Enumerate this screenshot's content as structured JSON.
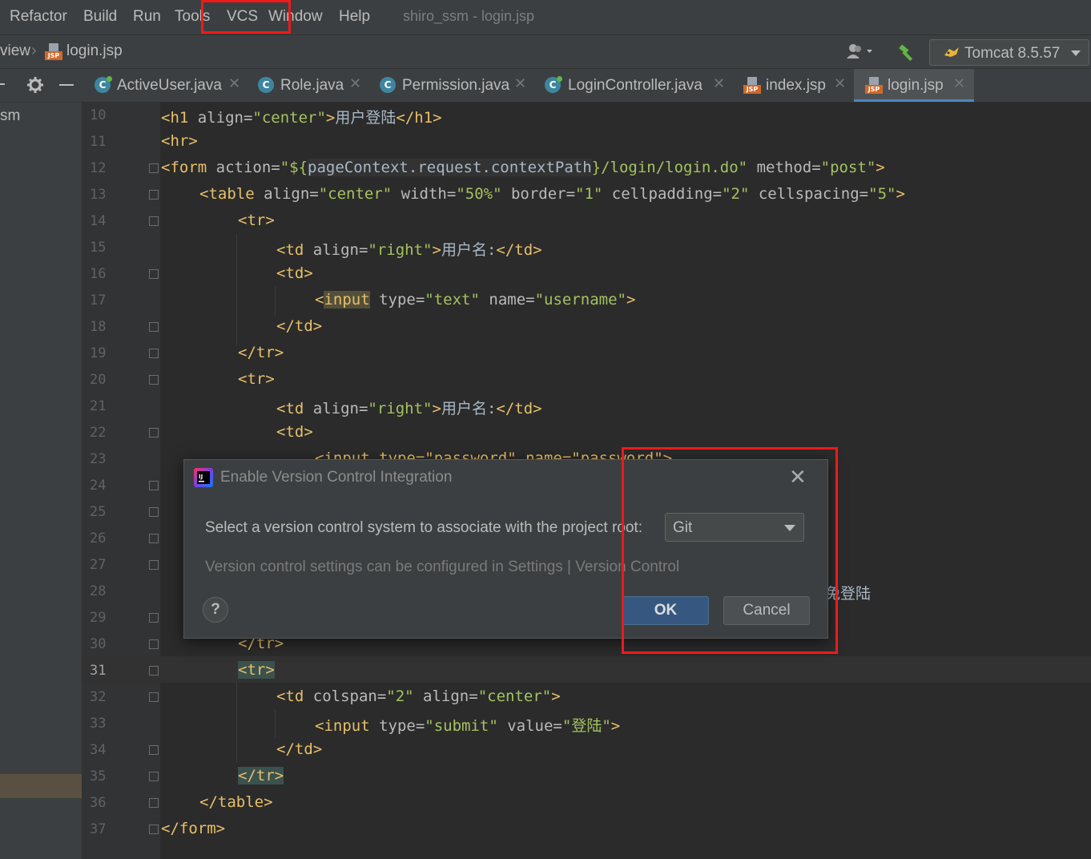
{
  "menu": [
    "Refactor",
    "Build",
    "Run",
    "Tools",
    "VCS",
    "Window",
    "Help"
  ],
  "window_title": "shiro_ssm - login.jsp",
  "nav": {
    "crumb_view": "view",
    "crumb_file": "login.jsp",
    "run_config": "Tomcat 8.5.57"
  },
  "side": {
    "project_fragment": "sm"
  },
  "tabs": [
    {
      "label": "ActiveUser.java",
      "kind": "class"
    },
    {
      "label": "Role.java",
      "kind": "class"
    },
    {
      "label": "Permission.java",
      "kind": "class"
    },
    {
      "label": "LoginController.java",
      "kind": "class"
    },
    {
      "label": "index.jsp",
      "kind": "jsp"
    },
    {
      "label": "login.jsp",
      "kind": "jsp",
      "active": true
    }
  ],
  "line_numbers": [
    "10",
    "11",
    "12",
    "13",
    "14",
    "15",
    "16",
    "17",
    "18",
    "19",
    "20",
    "21",
    "22",
    "23",
    "24",
    "25",
    "26",
    "27",
    "28",
    "29",
    "30",
    "31",
    "32",
    "33",
    "34",
    "35",
    "36",
    "37"
  ],
  "code": {
    "l10": {
      "open": "<h1 ",
      "attr": "align=",
      "val": "\"center\"",
      "close": ">",
      "text": "用户登陆",
      "end": "</h1>"
    },
    "l11": "<hr>",
    "l12": {
      "open": "<form ",
      "attr": "action=",
      "val1": "\"${",
      "expr": "pageContext.request.contextPath",
      "val2": "}/login/login.do\"",
      "attr2": " method=",
      "val3": "\"post\"",
      "close": ">"
    },
    "l13": {
      "open": "<table ",
      "attr1": "align=",
      "val1": "\"center\"",
      "attr2": " width=",
      "val2": "\"50%\"",
      "attr3": " border=",
      "val3": "\"1\"",
      "attr4": " cellpadding=",
      "val4": "\"2\"",
      "attr5": " cellspacing=",
      "val5": "\"5\"",
      "close": ">"
    },
    "l14": "<tr>",
    "l15": {
      "open": "<td ",
      "attr": "align=",
      "val": "\"right\"",
      "close": ">",
      "text": "用户名:",
      "end": "</td>"
    },
    "l16": "<td>",
    "l17": {
      "lt": "<",
      "tag": "input",
      "attr1": " type=",
      "val1": "\"text\"",
      "attr2": " name=",
      "val2": "\"username\"",
      "close": ">"
    },
    "l18": "</td>",
    "l19": "</tr>",
    "l20": "<tr>",
    "l21": {
      "open": "<td ",
      "attr": "align=",
      "val": "\"right\"",
      "close": ">",
      "text": "用户名:",
      "end": "</td>"
    },
    "l22": "<td>",
    "l23_fragment": "<input type=\"password\" name=\"password\">",
    "l28_fragment": "免登陆",
    "l30": "</tr>",
    "l31": "<tr>",
    "l32": {
      "open": "<td ",
      "attr1": "colspan=",
      "val1": "\"2\"",
      "attr2": " align=",
      "val2": "\"center\"",
      "close": ">"
    },
    "l33": {
      "open": "<input ",
      "attr1": "type=",
      "val1": "\"submit\"",
      "attr2": " value=",
      "val2": "\"登陆\"",
      "close": ">"
    },
    "l34": "</td>",
    "l35": "</tr>",
    "l36": "</table>",
    "l37": "</form>"
  },
  "dialog": {
    "title": "Enable Version Control Integration",
    "prompt": "Select a version control system to associate with the project root:",
    "selected_vcs": "Git",
    "hint": "Version control settings can be configured in Settings | Version Control",
    "ok_label": "OK",
    "cancel_label": "Cancel",
    "help_label": "?"
  },
  "colors": {
    "highlight_box": "#ee1a1a",
    "ok_button": "#365880",
    "accent": "#4a88c7"
  }
}
